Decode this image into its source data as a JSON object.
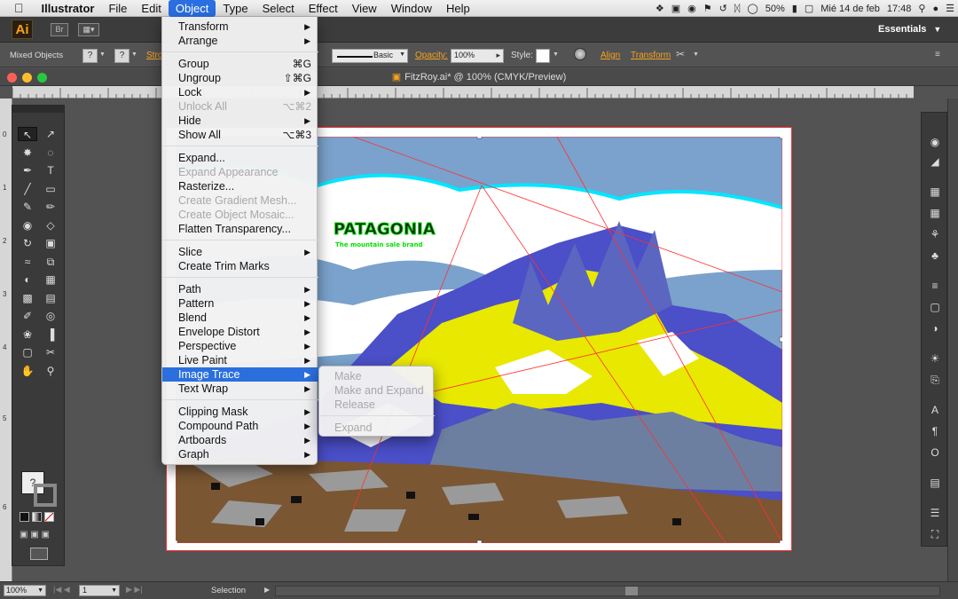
{
  "menubar": {
    "apple": "",
    "app": "Illustrator",
    "items": [
      "File",
      "Edit",
      "Object",
      "Type",
      "Select",
      "Effect",
      "View",
      "Window",
      "Help"
    ],
    "active_item": "Object",
    "tray": {
      "battery": "50%",
      "datetime": "Mié 14 de feb",
      "time": "17:48"
    }
  },
  "appbar": {
    "logo": "Ai",
    "bridge": "Br",
    "workspace": "Essentials"
  },
  "controlbar": {
    "selection": "Mixed Objects",
    "stroke_label": "Stro",
    "brush": "Basic",
    "opacity_label": "Opacity:",
    "opacity_value": "100%",
    "style_label": "Style:",
    "align_link": "Align",
    "transform_link": "Transform"
  },
  "document": {
    "title": "FitzRoy.ai* @ 100% (CMYK/Preview)"
  },
  "artwork": {
    "brand": "PATAGONIA",
    "tagline": "The mountain sale brand"
  },
  "object_menu": [
    {
      "label": "Transform",
      "submenu": true
    },
    {
      "label": "Arrange",
      "submenu": true
    },
    {
      "sep": true
    },
    {
      "label": "Group",
      "shortcut": "⌘G"
    },
    {
      "label": "Ungroup",
      "shortcut": "⇧⌘G"
    },
    {
      "label": "Lock",
      "submenu": true
    },
    {
      "label": "Unlock All",
      "shortcut": "⌥⌘2",
      "disabled": true
    },
    {
      "label": "Hide",
      "submenu": true
    },
    {
      "label": "Show All",
      "shortcut": "⌥⌘3"
    },
    {
      "sep": true
    },
    {
      "label": "Expand..."
    },
    {
      "label": "Expand Appearance",
      "disabled": true
    },
    {
      "label": "Rasterize..."
    },
    {
      "label": "Create Gradient Mesh...",
      "disabled": true
    },
    {
      "label": "Create Object Mosaic...",
      "disabled": true
    },
    {
      "label": "Flatten Transparency..."
    },
    {
      "sep": true
    },
    {
      "label": "Slice",
      "submenu": true
    },
    {
      "label": "Create Trim Marks"
    },
    {
      "sep": true
    },
    {
      "label": "Path",
      "submenu": true
    },
    {
      "label": "Pattern",
      "submenu": true
    },
    {
      "label": "Blend",
      "submenu": true
    },
    {
      "label": "Envelope Distort",
      "submenu": true
    },
    {
      "label": "Perspective",
      "submenu": true
    },
    {
      "label": "Live Paint",
      "submenu": true
    },
    {
      "label": "Image Trace",
      "submenu": true,
      "highlighted": true
    },
    {
      "label": "Text Wrap",
      "submenu": true
    },
    {
      "sep": true
    },
    {
      "label": "Clipping Mask",
      "submenu": true
    },
    {
      "label": "Compound Path",
      "submenu": true
    },
    {
      "label": "Artboards",
      "submenu": true
    },
    {
      "label": "Graph",
      "submenu": true
    }
  ],
  "image_trace_submenu": [
    {
      "label": "Make",
      "disabled": true
    },
    {
      "label": "Make and Expand",
      "disabled": true
    },
    {
      "label": "Release",
      "disabled": true
    },
    {
      "sep": true
    },
    {
      "label": "Expand",
      "disabled": true
    }
  ],
  "statusbar": {
    "zoom": "100%",
    "artboard": "1",
    "mode": "Selection"
  },
  "ruler_numbers": [
    "0",
    "1",
    "2",
    "3",
    "4",
    "5",
    "6"
  ],
  "tools": [
    "selection-icon",
    "direct-selection-icon",
    "magic-wand-icon",
    "lasso-icon",
    "pen-icon",
    "type-icon",
    "line-icon",
    "rectangle-icon",
    "paintbrush-icon",
    "pencil-icon",
    "blob-brush-icon",
    "eraser-icon",
    "rotate-icon",
    "scale-icon",
    "width-icon",
    "free-transform-icon",
    "shape-builder-icon",
    "perspective-grid-icon",
    "mesh-icon",
    "gradient-icon",
    "eyedropper-icon",
    "blend-icon",
    "symbol-sprayer-icon",
    "column-graph-icon",
    "artboard-icon",
    "slice-icon",
    "hand-icon",
    "zoom-icon"
  ]
}
